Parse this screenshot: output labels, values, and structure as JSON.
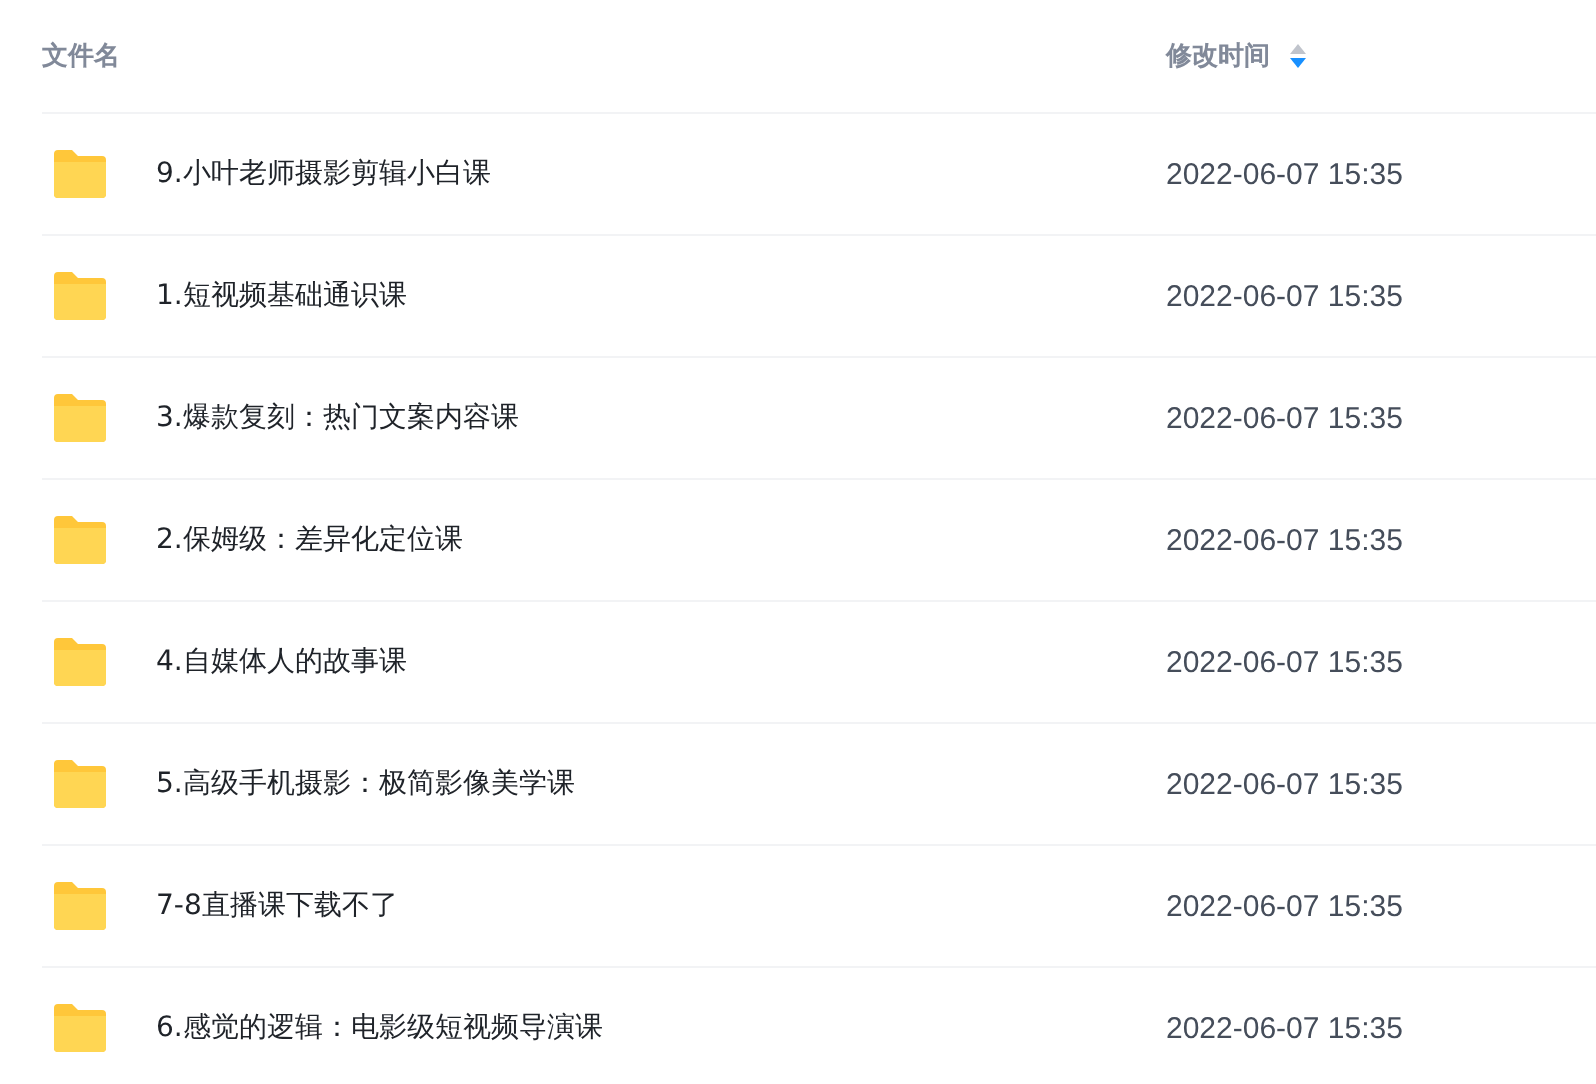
{
  "table": {
    "columns": [
      {
        "label": "文件名"
      },
      {
        "label": "修改时间",
        "sorted_descending": true
      }
    ],
    "rows": [
      {
        "name": "9.小叶老师摄影剪辑小白课",
        "modified": "2022-06-07 15:35"
      },
      {
        "name": "1.短视频基础通识课",
        "modified": "2022-06-07 15:35"
      },
      {
        "name": "3.爆款复刻：热门文案内容课",
        "modified": "2022-06-07 15:35"
      },
      {
        "name": "2.保姆级：差异化定位课",
        "modified": "2022-06-07 15:35"
      },
      {
        "name": "4.自媒体人的故事课",
        "modified": "2022-06-07 15:35"
      },
      {
        "name": "5.高级手机摄影：极简影像美学课",
        "modified": "2022-06-07 15:35"
      },
      {
        "name": "7-8直播课下载不了",
        "modified": "2022-06-07 15:35"
      },
      {
        "name": "6.感觉的逻辑：电影级短视频导演课",
        "modified": "2022-06-07 15:35"
      }
    ]
  }
}
